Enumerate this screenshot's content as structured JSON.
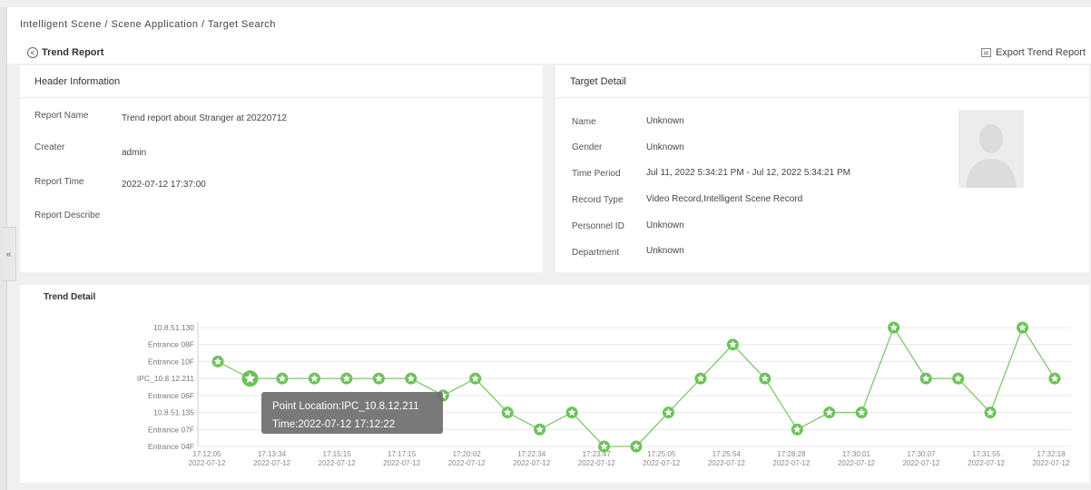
{
  "breadcrumb": "Intelligent Scene / Scene Application / Target Search",
  "page_title": "Trend Report",
  "export_label": "Export Trend Report",
  "collapse_glyph": "«",
  "header_info": {
    "title": "Header Information",
    "fields": [
      {
        "label": "Report Name",
        "value": "Trend report about Stranger at 20220712"
      },
      {
        "label": "Creater",
        "value": "admin"
      },
      {
        "label": "Report Time",
        "value": "2022-07-12 17:37:00"
      },
      {
        "label": "Report Describe",
        "value": ""
      }
    ]
  },
  "target_detail": {
    "title": "Target Detail",
    "fields": [
      {
        "label": "Name",
        "value": "Unknown"
      },
      {
        "label": "Gender",
        "value": "Unknown"
      },
      {
        "label": "Time Period",
        "value": "Jul 11, 2022 5:34:21 PM - Jul 12, 2022 5:34:21 PM"
      },
      {
        "label": "Record Type",
        "value": "Video Record,Intelligent Scene Record"
      },
      {
        "label": "Personnel ID",
        "value": "Unknown"
      },
      {
        "label": "Department",
        "value": "Unknown"
      }
    ]
  },
  "trend": {
    "title": "Trend Detail",
    "tooltip": {
      "line1": "Point Location:IPC_10.8.12.211",
      "line2": "Time:2022-07-12 17:12:22"
    }
  },
  "colors": {
    "line": "#7dc96b",
    "marker": "#6cc25a",
    "tooltip_bg": "#6e6e6e"
  },
  "chart_data": {
    "type": "line",
    "y_categories": [
      "Entrance 04F",
      "Entrance 07F",
      "10.8.51.135",
      "Entrance 06F",
      "IPC_10.8.12.211",
      "Entrance 10F",
      "Entrance 08F",
      "10.8.51.130"
    ],
    "x_ticks": [
      {
        "time": "17:12:05",
        "date": "2022-07-12"
      },
      {
        "time": "17:13:34",
        "date": "2022-07-12"
      },
      {
        "time": "17:15:15",
        "date": "2022-07-12"
      },
      {
        "time": "17:17:15",
        "date": "2022-07-12"
      },
      {
        "time": "17:20:02",
        "date": "2022-07-12"
      },
      {
        "time": "17:22:34",
        "date": "2022-07-12"
      },
      {
        "time": "17:23:47",
        "date": "2022-07-12"
      },
      {
        "time": "17:25:05",
        "date": "2022-07-12"
      },
      {
        "time": "17:25:54",
        "date": "2022-07-12"
      },
      {
        "time": "17:28:28",
        "date": "2022-07-12"
      },
      {
        "time": "17:30:01",
        "date": "2022-07-12"
      },
      {
        "time": "17:30:07",
        "date": "2022-07-12"
      },
      {
        "time": "17:31:55",
        "date": "2022-07-12"
      },
      {
        "time": "17:32:18",
        "date": "2022-07-12"
      }
    ],
    "points": [
      "Entrance 10F",
      "IPC_10.8.12.211",
      "IPC_10.8.12.211",
      "IPC_10.8.12.211",
      "IPC_10.8.12.211",
      "IPC_10.8.12.211",
      "IPC_10.8.12.211",
      "Entrance 06F",
      "IPC_10.8.12.211",
      "10.8.51.135",
      "Entrance 07F",
      "10.8.51.135",
      "Entrance 04F",
      "Entrance 04F",
      "10.8.51.135",
      "IPC_10.8.12.211",
      "Entrance 08F",
      "IPC_10.8.12.211",
      "Entrance 07F",
      "10.8.51.135",
      "10.8.51.135",
      "10.8.51.130",
      "IPC_10.8.12.211",
      "IPC_10.8.12.211",
      "10.8.51.135",
      "10.8.51.130",
      "IPC_10.8.12.211"
    ],
    "highlighted_point_index": 1,
    "grid": true,
    "legend": "none"
  }
}
